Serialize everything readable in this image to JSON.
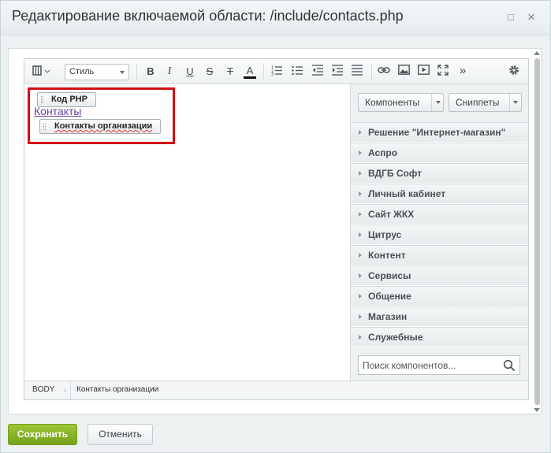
{
  "dialog": {
    "title": "Редактирование включаемой области: /include/contacts.php",
    "buttons": {
      "minimize": "□",
      "close": "×"
    }
  },
  "toolbar": {
    "style_select": "Стиль",
    "bold": "B",
    "italic": "I",
    "underline": "U",
    "strike": "S",
    "remove_format": "T",
    "font_color": "A",
    "more": "»",
    "icons": [
      "layout-icon",
      "ordered-list-icon",
      "unordered-list-icon",
      "outdent-icon",
      "indent-icon",
      "justify-icon",
      "link-icon",
      "image-icon",
      "video-icon",
      "fullscreen-icon",
      "settings-icon"
    ]
  },
  "editor": {
    "php_chip": "Код PHP",
    "link_text": "Контакты",
    "component_chip": "Контакты организации"
  },
  "sidebar": {
    "components_button": "Компоненты",
    "snippets_button": "Сниппеты",
    "groups": [
      "Решение \"Интернет-магазин\"",
      "Аспро",
      "ВДГБ Софт",
      "Личный кабинет",
      "Сайт ЖКХ",
      "Цитрус",
      "Контент",
      "Сервисы",
      "Общение",
      "Магазин",
      "Служебные"
    ],
    "search_placeholder": "Поиск компонентов..."
  },
  "statusbar": {
    "crumb_body": "BODY",
    "crumb_sep": "›",
    "crumb_component": "Контакты организации"
  },
  "footer": {
    "save": "Сохранить",
    "cancel": "Отменить"
  },
  "colors": {
    "save_green": "#8ab52a",
    "highlight_red": "#d40e12",
    "link_purple": "#6b3fa0"
  }
}
